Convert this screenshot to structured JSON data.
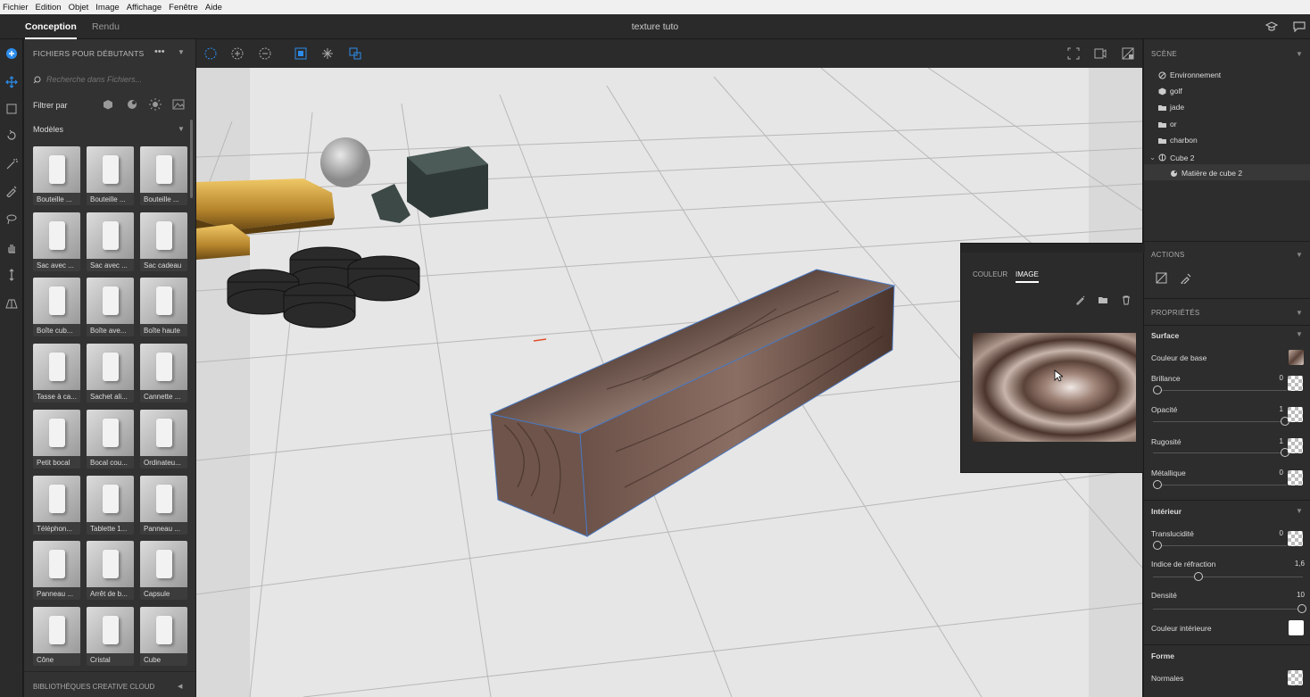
{
  "menu": [
    "Fichier",
    "Edition",
    "Objet",
    "Image",
    "Affichage",
    "Fenêtre",
    "Aide"
  ],
  "tabs": {
    "conception": "Conception",
    "rendu": "Rendu"
  },
  "document_title": "texture tuto",
  "library": {
    "header": "FICHIERS POUR DÉBUTANTS",
    "search_placeholder": "Recherche dans Fichiers...",
    "filter_label": "Filtrer par",
    "models_label": "Modèles",
    "models": [
      "Bouteille ...",
      "Bouteille ...",
      "Bouteille ...",
      "Sac avec ...",
      "Sac avec ...",
      "Sac cadeau",
      "Boîte cub...",
      "Boîte ave...",
      "Boîte haute",
      "Tasse à ca...",
      "Sachet ali...",
      "Cannette ...",
      "Petit bocal",
      "Bocal cou...",
      "Ordinateu...",
      "Téléphon...",
      "Tablette 1...",
      "Panneau ...",
      "Panneau ...",
      "Arrêt de b...",
      "Capsule",
      "Cône",
      "Cristal",
      "Cube"
    ],
    "cc_libraries": "BIBLIOTHÈQUES CREATIVE CLOUD"
  },
  "scene": {
    "header": "SCÈNE",
    "items": [
      "Environnement",
      "golf",
      "jade",
      "or",
      "charbon",
      "Cube 2",
      "Matière de cube 2"
    ]
  },
  "actions_header": "ACTIONS",
  "properties": {
    "header": "PROPRIÉTÉS",
    "surface": "Surface",
    "base_color": "Couleur de base",
    "brillance": {
      "label": "Brillance",
      "value": "0",
      "level": 0
    },
    "opacite": {
      "label": "Opacité",
      "value": "1",
      "level": 1
    },
    "rugosite": {
      "label": "Rugosité",
      "value": "1",
      "level": 1
    },
    "metallique": {
      "label": "Métallique",
      "value": "0",
      "level": 0
    },
    "interieur": "Intérieur",
    "translucidite": {
      "label": "Translucidité",
      "value": "0",
      "level": 0
    },
    "refraction": {
      "label": "Indice de réfraction",
      "value": "1,6",
      "level": 0.3
    },
    "densite": {
      "label": "Densité",
      "value": "10",
      "level": 1
    },
    "interior_color": "Couleur intérieure",
    "forme": "Forme",
    "normales": "Normales"
  },
  "popup": {
    "tab_color": "COULEUR",
    "tab_image": "IMAGE"
  },
  "colors": {
    "accent": "#2d8ceb",
    "wood": "#6b5148",
    "gold": "#c89a3a"
  }
}
